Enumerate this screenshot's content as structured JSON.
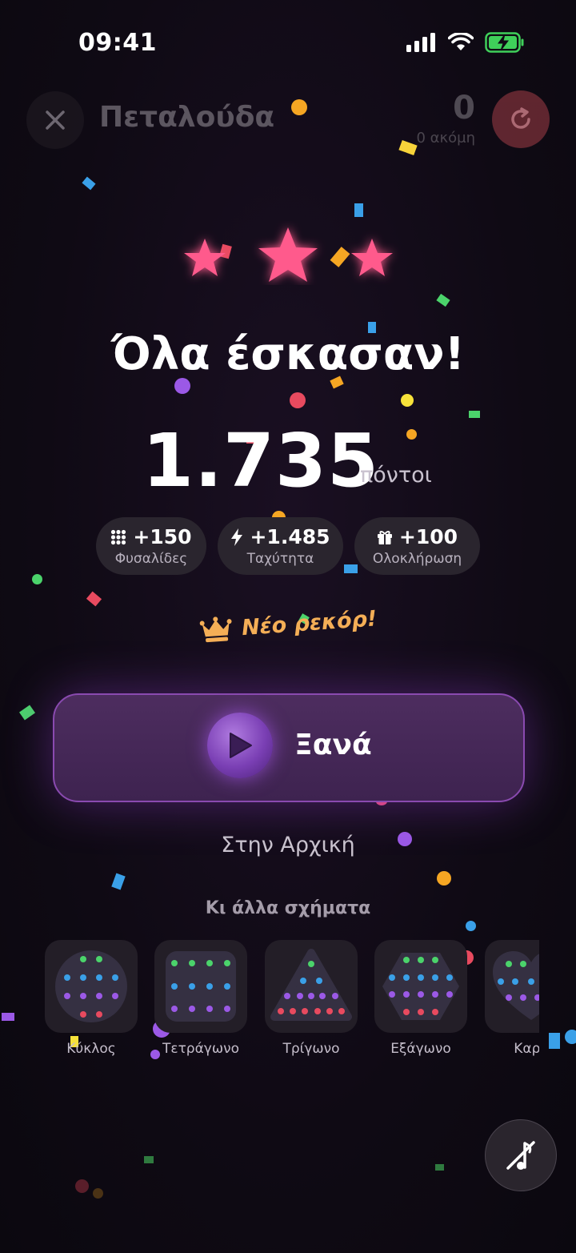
{
  "status_bar": {
    "time": "09:41"
  },
  "header": {
    "title": "Πεταλούδα",
    "score": "0",
    "remaining": "0 ακόμη"
  },
  "result": {
    "stars_earned": 3,
    "headline": "Όλα έσκασαν!",
    "points": "1.735",
    "points_unit": "πόντοι"
  },
  "breakdown": [
    {
      "icon": "grid-icon",
      "value": "+150",
      "label": "Φυσαλίδες"
    },
    {
      "icon": "bolt-icon",
      "value": "+1.485",
      "label": "Ταχύτητα"
    },
    {
      "icon": "gift-icon",
      "value": "+100",
      "label": "Ολοκλήρωση"
    }
  ],
  "record": {
    "icon": "crown-icon",
    "text": "Νέο ρεκόρ!"
  },
  "actions": {
    "play_again": "Ξανά",
    "home": "Στην Αρχική"
  },
  "more_shapes": {
    "title": "Κι άλλα σχήματα",
    "items": [
      {
        "name": "Κύκλος"
      },
      {
        "name": "Τετράγωνο"
      },
      {
        "name": "Τρίγωνο"
      },
      {
        "name": "Εξάγωνο"
      },
      {
        "name": "Καρδ"
      }
    ]
  },
  "colors": {
    "accent_purple": "#8a4ab0",
    "star_pink": "#ff5a8c",
    "record_orange": "#f4ae56",
    "reset_red": "#6e2b35"
  }
}
